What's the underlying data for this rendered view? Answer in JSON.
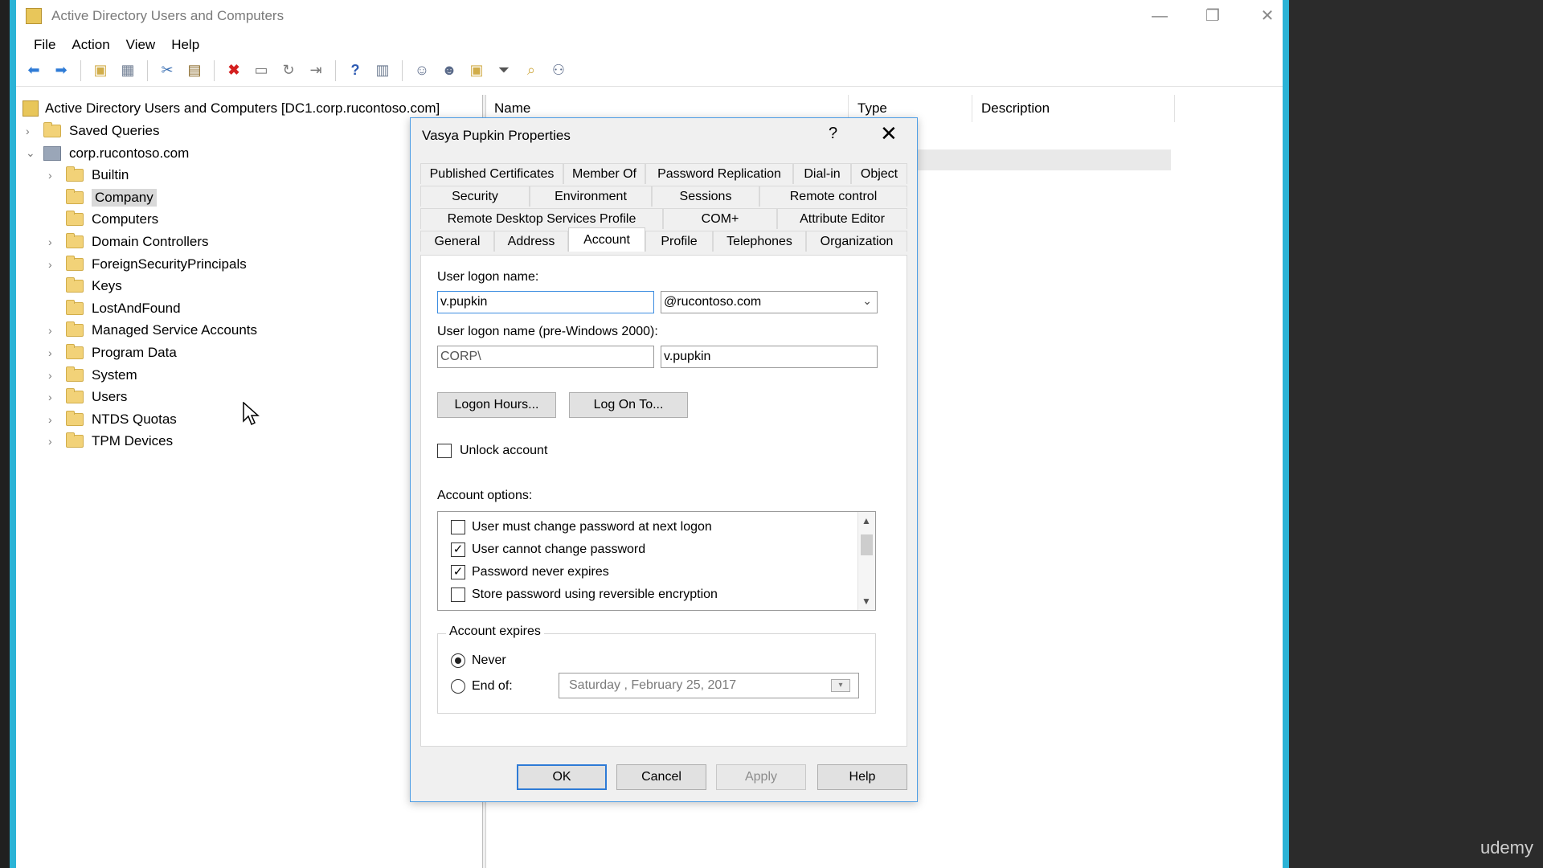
{
  "app": {
    "title": "Active Directory Users and Computers",
    "window_controls": {
      "minimize": "—",
      "maximize": "❐",
      "close": "✕"
    }
  },
  "menu": [
    "File",
    "Action",
    "View",
    "Help"
  ],
  "toolbar": {
    "icons": [
      "back-icon",
      "forward-icon",
      "up-folder-icon",
      "show-hide-console-tree-icon",
      "cut-icon",
      "copy-icon",
      "delete-icon",
      "properties-icon",
      "refresh-icon",
      "export-list-icon",
      "help-icon",
      "console-tree-view-icon",
      "add-user-icon",
      "add-group-icon",
      "add-ou-icon",
      "filter-icon",
      "find-icon",
      "add-to-group-icon"
    ]
  },
  "tree": {
    "root": "Active Directory Users and Computers [DC1.corp.rucontoso.com]",
    "items": [
      {
        "label": "Saved Queries",
        "level": 1,
        "expander": "›"
      },
      {
        "label": "corp.rucontoso.com",
        "level": 1,
        "expander": "⌄"
      },
      {
        "label": "Builtin",
        "level": 2,
        "expander": "›"
      },
      {
        "label": "Company",
        "level": 2,
        "expander": "",
        "selected": true
      },
      {
        "label": "Computers",
        "level": 2,
        "expander": ""
      },
      {
        "label": "Domain Controllers",
        "level": 2,
        "expander": "›"
      },
      {
        "label": "ForeignSecurityPrincipals",
        "level": 2,
        "expander": "›"
      },
      {
        "label": "Keys",
        "level": 2,
        "expander": ""
      },
      {
        "label": "LostAndFound",
        "level": 2,
        "expander": ""
      },
      {
        "label": "Managed Service Accounts",
        "level": 2,
        "expander": "›"
      },
      {
        "label": "Program Data",
        "level": 2,
        "expander": "›"
      },
      {
        "label": "System",
        "level": 2,
        "expander": "›"
      },
      {
        "label": "Users",
        "level": 2,
        "expander": "›"
      },
      {
        "label": "NTDS Quotas",
        "level": 2,
        "expander": "›"
      },
      {
        "label": "TPM Devices",
        "level": 2,
        "expander": "›"
      }
    ]
  },
  "list": {
    "columns": [
      "Name",
      "Type",
      "Description"
    ]
  },
  "dialog": {
    "title": "Vasya Pupkin Properties",
    "help": "?",
    "close": "✕",
    "tabs": [
      [
        "Published Certificates",
        "Member Of",
        "Password Replication",
        "Dial-in",
        "Object"
      ],
      [
        "Security",
        "Environment",
        "Sessions",
        "Remote control"
      ],
      [
        "Remote Desktop Services Profile",
        "COM+",
        "Attribute Editor"
      ],
      [
        "General",
        "Address",
        "Account",
        "Profile",
        "Telephones",
        "Organization"
      ]
    ],
    "active_tab": "Account",
    "account": {
      "logon_name_label": "User logon name:",
      "logon_name": "v.pupkin",
      "upn_suffix": "@rucontoso.com",
      "pre2000_label": "User logon name (pre-Windows 2000):",
      "pre2000_domain": "CORP\\",
      "pre2000_name": "v.pupkin",
      "logon_hours_btn": "Logon Hours...",
      "log_on_to_btn": "Log On To...",
      "unlock_label": "Unlock account",
      "unlock_checked": false,
      "options_label": "Account options:",
      "options": [
        {
          "label": "User must change password at next logon",
          "checked": false
        },
        {
          "label": "User cannot change password",
          "checked": true
        },
        {
          "label": "Password never expires",
          "checked": true
        },
        {
          "label": "Store password using reversible encryption",
          "checked": false
        }
      ],
      "expires_label": "Account expires",
      "never_label": "Never",
      "never_selected": true,
      "end_of_label": "End of:",
      "end_of_date": "Saturday   ,   February   25, 2017"
    },
    "buttons": {
      "ok": "OK",
      "cancel": "Cancel",
      "apply": "Apply",
      "help": "Help"
    }
  },
  "watermark": "udemy"
}
